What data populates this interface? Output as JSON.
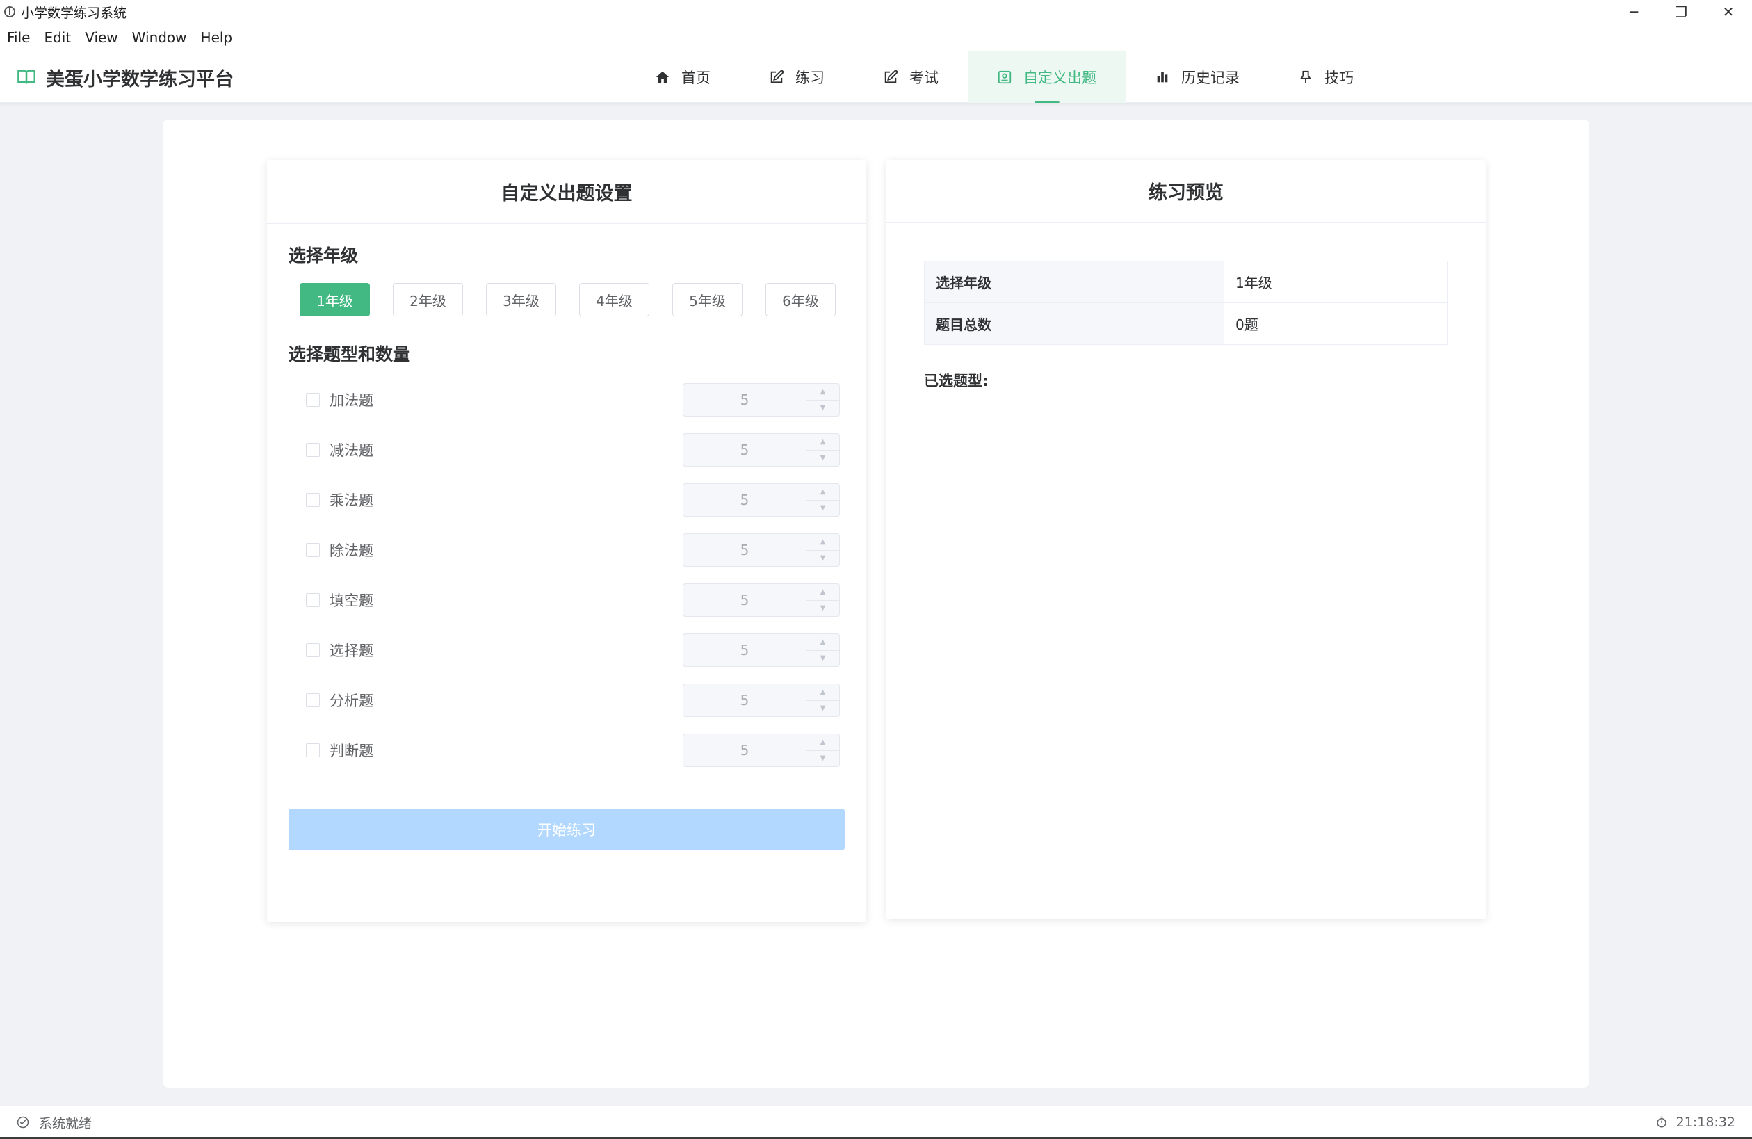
{
  "window": {
    "title": "小学数学练习系统",
    "minimize": "─",
    "restore": "❐",
    "close": "✕"
  },
  "menu": [
    "File",
    "Edit",
    "View",
    "Window",
    "Help"
  ],
  "brand": {
    "name": "美蛋小学数学练习平台",
    "icon": "book-icon"
  },
  "nav": [
    {
      "label": "首页",
      "icon": "home-icon"
    },
    {
      "label": "练习",
      "icon": "edit-icon"
    },
    {
      "label": "考试",
      "icon": "edit-icon"
    },
    {
      "label": "自定义出题",
      "icon": "custom-icon",
      "active": true
    },
    {
      "label": "历史记录",
      "icon": "bar-chart-icon"
    },
    {
      "label": "技巧",
      "icon": "pushpin-icon"
    }
  ],
  "settings": {
    "title": "自定义出题设置",
    "grade_title": "选择年级",
    "grades": [
      "1年级",
      "2年级",
      "3年级",
      "4年级",
      "5年级",
      "6年级"
    ],
    "selected_grade_index": 0,
    "qtype_title": "选择题型和数量",
    "qtypes": [
      {
        "label": "加法题",
        "count": "5"
      },
      {
        "label": "减法题",
        "count": "5"
      },
      {
        "label": "乘法题",
        "count": "5"
      },
      {
        "label": "除法题",
        "count": "5"
      },
      {
        "label": "填空题",
        "count": "5"
      },
      {
        "label": "选择题",
        "count": "5"
      },
      {
        "label": "分析题",
        "count": "5"
      },
      {
        "label": "判断题",
        "count": "5"
      }
    ],
    "start_label": "开始练习"
  },
  "preview": {
    "title": "练习预览",
    "rows": [
      {
        "label": "选择年级",
        "value": "1年级"
      },
      {
        "label": "题目总数",
        "value": "0题"
      }
    ],
    "selected_types_label": "已选题型:"
  },
  "status": {
    "text": "系统就绪",
    "time": "21:18:32"
  },
  "colors": {
    "accent": "#42b983",
    "disabled_button": "#b3d8ff"
  }
}
